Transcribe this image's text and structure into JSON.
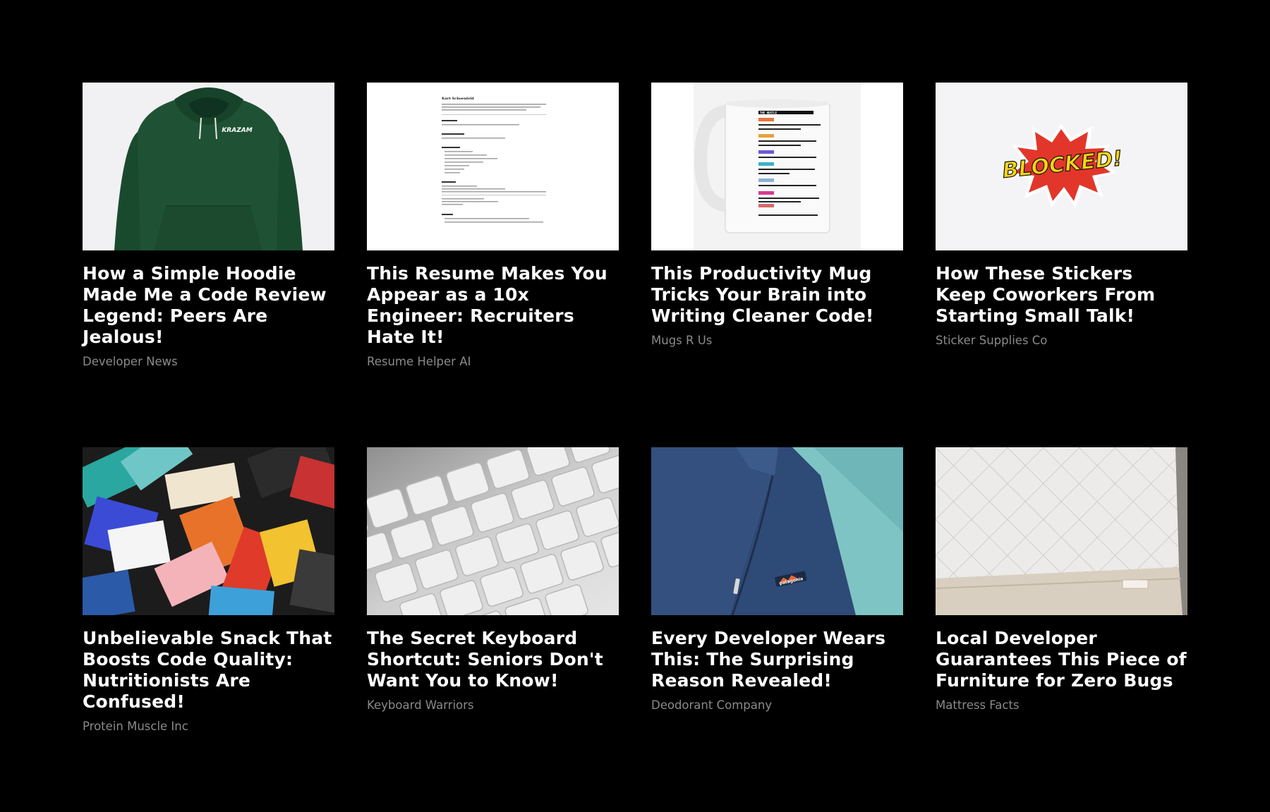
{
  "articles": [
    {
      "headline": "How a Simple Hoodie Made Me a Code Review Legend: Peers Are Jealous!",
      "source": "Developer News",
      "image": "green-hoodie",
      "image_text": "KRAZAM"
    },
    {
      "headline": "This Resume Makes You Appear as a 10x Engineer: Recruiters Hate It!",
      "source": "Resume Helper AI",
      "image": "resume-document",
      "image_text": "Kurt Schoenfeld"
    },
    {
      "headline": "This Productivity Mug Tricks Your Brain into Writing Cleaner Code!",
      "source": "Mugs R Us",
      "image": "schedule-mug",
      "image_text": "THE HUSTLE"
    },
    {
      "headline": "How These Stickers Keep Coworkers From Starting Small Talk!",
      "source": "Sticker Supplies Co",
      "image": "blocked-sticker",
      "image_text": "BLOCKED!"
    },
    {
      "headline": "Unbelievable Snack That Boosts Code Quality: Nutritionists Are Confused!",
      "source": "Protein Muscle Inc",
      "image": "snack-bars",
      "image_text": ""
    },
    {
      "headline": "The Secret Keyboard Shortcut: Seniors Don't Want You to Know!",
      "source": "Keyboard Warriors",
      "image": "keyboard-closeup",
      "image_text": ""
    },
    {
      "headline": "Every Developer Wears This: The Surprising Reason Revealed!",
      "source": "Deodorant Company",
      "image": "fleece-vest",
      "image_text": "patagonia"
    },
    {
      "headline": "Local Developer Guarantees This Piece of Furniture for Zero Bugs",
      "source": "Mattress Facts",
      "image": "mattress",
      "image_text": ""
    }
  ]
}
